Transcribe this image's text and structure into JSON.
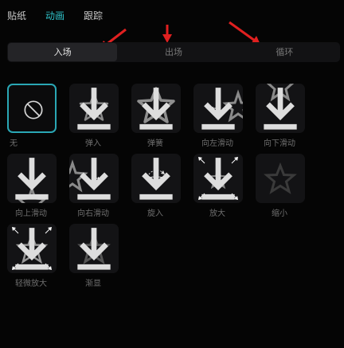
{
  "tabs": [
    {
      "label": "贴纸"
    },
    {
      "label": "动画"
    },
    {
      "label": "跟踪"
    }
  ],
  "segments": [
    {
      "label": "入场"
    },
    {
      "label": "出场"
    },
    {
      "label": "循环"
    }
  ],
  "items": [
    {
      "label": "无"
    },
    {
      "label": "弹入"
    },
    {
      "label": "弹簧"
    },
    {
      "label": "向左滑动"
    },
    {
      "label": "向下滑动"
    },
    {
      "label": "向上滑动"
    },
    {
      "label": "向右滑动"
    },
    {
      "label": "旋入"
    },
    {
      "label": "放大"
    },
    {
      "label": "缩小"
    },
    {
      "label": "轻微放大"
    },
    {
      "label": "渐显"
    }
  ],
  "colors": {
    "accent": "#2fc2c9",
    "annotation": "#e02020"
  },
  "icons": {
    "none": "prohibit-icon",
    "thumb": "star-icon",
    "download": "download-icon"
  }
}
